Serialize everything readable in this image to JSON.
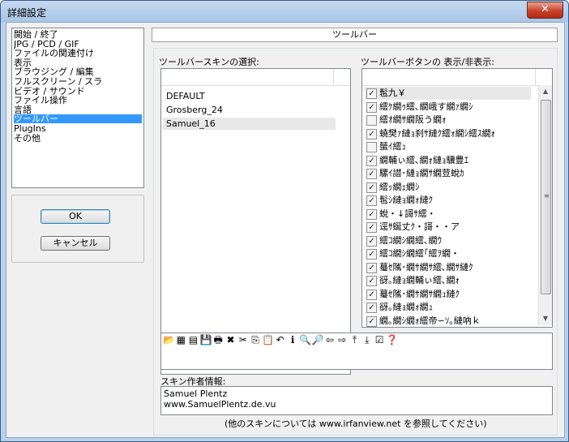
{
  "window": {
    "title": "詳細設定",
    "close_symbol": "✕"
  },
  "nav": {
    "items": [
      {
        "label": "開始 / 終了"
      },
      {
        "label": "JPG / PCD / GIF"
      },
      {
        "label": "ファイルの関連付け"
      },
      {
        "label": "表示"
      },
      {
        "label": "ブラウジング / 編集"
      },
      {
        "label": "フルスクリーン / スラ"
      },
      {
        "label": "ビデオ / サウンド"
      },
      {
        "label": "ファイル操作"
      },
      {
        "label": "言語"
      },
      {
        "label": "ツールバー"
      },
      {
        "label": "PlugIns"
      },
      {
        "label": "その他"
      }
    ],
    "selected_index": 9
  },
  "buttons": {
    "ok": "OK",
    "cancel": "キャンセル"
  },
  "page": {
    "header": "ツールバー",
    "skin_label": "ツールバースキンの選択:",
    "buttons_label": "ツールバーボタンの 表示/非表示:",
    "author_label": "スキン作者情報:",
    "footer": "(他のスキンについては www.irfanview.net を参照してください)"
  },
  "skins": [
    {
      "name": "DEFAULT"
    },
    {
      "name": "Grosberg_24"
    },
    {
      "name": "Samuel_16"
    }
  ],
  "selected_skin_index": 2,
  "toolbar_buttons": [
    {
      "label": "髢九￥",
      "checked": true
    },
    {
      "label": "繧ｹ繝ｩ繧､繝峨す繝ｧ繝ｼ",
      "checked": true
    },
    {
      "label": "繧ｵ繝ｻ繝阪う繝ｫ",
      "checked": false
    },
    {
      "label": "蟯樊ｧ縺ｮ刹ｻ縺ｸ繧ｫ繝ｼ繧ｽ繝ｫ",
      "checked": true
    },
    {
      "label": "蜑ｲ繧ｭ",
      "checked": false
    },
    {
      "label": "繝輔ぃ繧､繝ｫ縺ｮ驥豊ｴ",
      "checked": true
    },
    {
      "label": "騾ｲ譛･縺ｮ繝ｻ繝荳蛻ｶ",
      "checked": true
    },
    {
      "label": "繧ｯ繝ｪ繝ｼ",
      "checked": true
    },
    {
      "label": "髢ｼ縺ｮ繝ｫ縺ｸ",
      "checked": true
    },
    {
      "label": "蛻・↓謌ｻ繧・",
      "checked": true
    },
    {
      "label": "逕ｻ蜒丈ｸ・謌・・ア",
      "checked": true
    },
    {
      "label": "繧ｺ繝ｼ繝繧､繝ｳ",
      "checked": true
    },
    {
      "label": "繧ｺ繝ｼ繝繧｢繧ｦ繝・",
      "checked": true
    },
    {
      "label": "蟇ｾ隲･繝ｻ繝ｻ繧､繝ｻ縺ｸ",
      "checked": true
    },
    {
      "label": "谺｡縺ｮ繝輔ぃ繧､繝ｫ",
      "checked": true
    },
    {
      "label": "蟇ｾ隲･繝ｻ繝ｻ繝ｭ縺ｸ",
      "checked": true
    },
    {
      "label": "谺｡縺ｮ繝ｫ繝ｭ",
      "checked": true
    },
    {
      "label": "繝｡繝ｼ繝ｫ繧帝∽ｿ｡縺吶ｋ",
      "checked": true
    }
  ],
  "toolbar_preview_icons": [
    {
      "name": "open-folder-icon",
      "glyph": "📂"
    },
    {
      "name": "thumbnails-icon",
      "glyph": "▦"
    },
    {
      "name": "slideshow-icon",
      "glyph": "▤"
    },
    {
      "name": "save-icon",
      "glyph": "💾"
    },
    {
      "name": "print-icon",
      "glyph": "🖶"
    },
    {
      "name": "delete-icon",
      "glyph": "✖"
    },
    {
      "name": "cut-icon",
      "glyph": "✂"
    },
    {
      "name": "copy-icon",
      "glyph": "⎘"
    },
    {
      "name": "paste-icon",
      "glyph": "📋"
    },
    {
      "name": "undo-icon",
      "glyph": "↶"
    },
    {
      "name": "info-icon",
      "glyph": "ℹ"
    },
    {
      "name": "zoom-in-icon",
      "glyph": "🔍"
    },
    {
      "name": "zoom-out-icon",
      "glyph": "🔎"
    },
    {
      "name": "previous-icon",
      "glyph": "⇦"
    },
    {
      "name": "next-icon",
      "glyph": "⇨"
    },
    {
      "name": "first-icon",
      "glyph": "⤒"
    },
    {
      "name": "last-icon",
      "glyph": "⤓"
    },
    {
      "name": "checkmark-icon",
      "glyph": "☑"
    },
    {
      "name": "help-icon",
      "glyph": "❓"
    }
  ],
  "author": {
    "name": "Samuel Plentz",
    "site": "www.SamuelPlentz.de.vu"
  },
  "colors": {
    "selection": "#3399ff",
    "close_button": "#c8412c",
    "frame": "#b9d1ea"
  }
}
